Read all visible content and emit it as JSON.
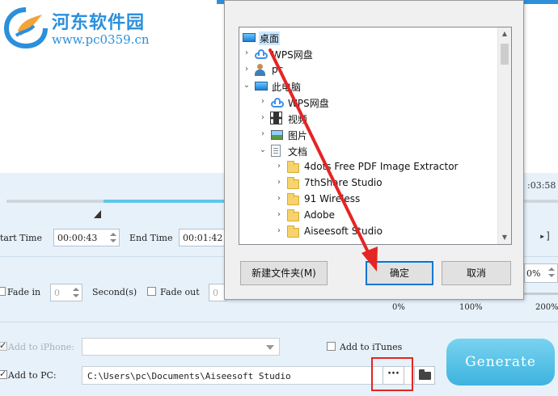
{
  "watermark": {
    "title": "河东软件园",
    "url": "www.pc0359.cn"
  },
  "trim": {
    "right_time": ":03:58",
    "start_label": "tart Time",
    "start_value": "00:00:43",
    "end_label": "End Time",
    "end_value": "00:01:42"
  },
  "fade": {
    "fade_in_label": "Fade in",
    "fade_in_value": "0",
    "seconds_label": "Second(s)",
    "fade_out_label": "Fade out",
    "fade_out_value": "0"
  },
  "volume": {
    "value": "0%",
    "scale_min": "0%",
    "scale_mid": "100%",
    "scale_max": "200%"
  },
  "output": {
    "add_iphone_label": "Add to iPhone:",
    "add_itunes_label": "Add to iTunes",
    "add_pc_label": "Add to PC:",
    "path": "C:\\Users\\pc\\Documents\\Aiseesoft Studio",
    "browse_label": "···",
    "generate_label": "Generate"
  },
  "dialog": {
    "tree": [
      {
        "label": "桌面",
        "icon": "monitor-icon",
        "arrow": "",
        "level": 0,
        "selected": true
      },
      {
        "label": "WPS网盘",
        "icon": "cloud-icon",
        "arrow": ">",
        "level": 0
      },
      {
        "label": "pc",
        "icon": "user-icon",
        "arrow": ">",
        "level": 0
      },
      {
        "label": "此电脑",
        "icon": "monitor-icon",
        "arrow": "v",
        "level": 0
      },
      {
        "label": "WPS网盘",
        "icon": "cloud-icon",
        "arrow": ">",
        "level": 1
      },
      {
        "label": "视频",
        "icon": "film-icon",
        "arrow": ">",
        "level": 1
      },
      {
        "label": "图片",
        "icon": "picture-icon",
        "arrow": ">",
        "level": 1
      },
      {
        "label": "文档",
        "icon": "document-icon",
        "arrow": "v",
        "level": 1
      },
      {
        "label": "4dots Free PDF Image Extractor",
        "icon": "folder-icon",
        "arrow": ">",
        "level": 2
      },
      {
        "label": "7thShare Studio",
        "icon": "folder-icon",
        "arrow": ">",
        "level": 2
      },
      {
        "label": "91 Wireless",
        "icon": "folder-icon",
        "arrow": ">",
        "level": 2
      },
      {
        "label": "Adobe",
        "icon": "folder-icon",
        "arrow": ">",
        "level": 2
      },
      {
        "label": "Aiseesoft Studio",
        "icon": "folder-icon",
        "arrow": ">",
        "level": 2
      }
    ],
    "new_folder_label": "新建文件夹(M)",
    "ok_label": "确定",
    "cancel_label": "取消"
  },
  "colors": {
    "accent": "#2f8fd8",
    "annotation": "#e52424",
    "generate": "#3db3df"
  }
}
